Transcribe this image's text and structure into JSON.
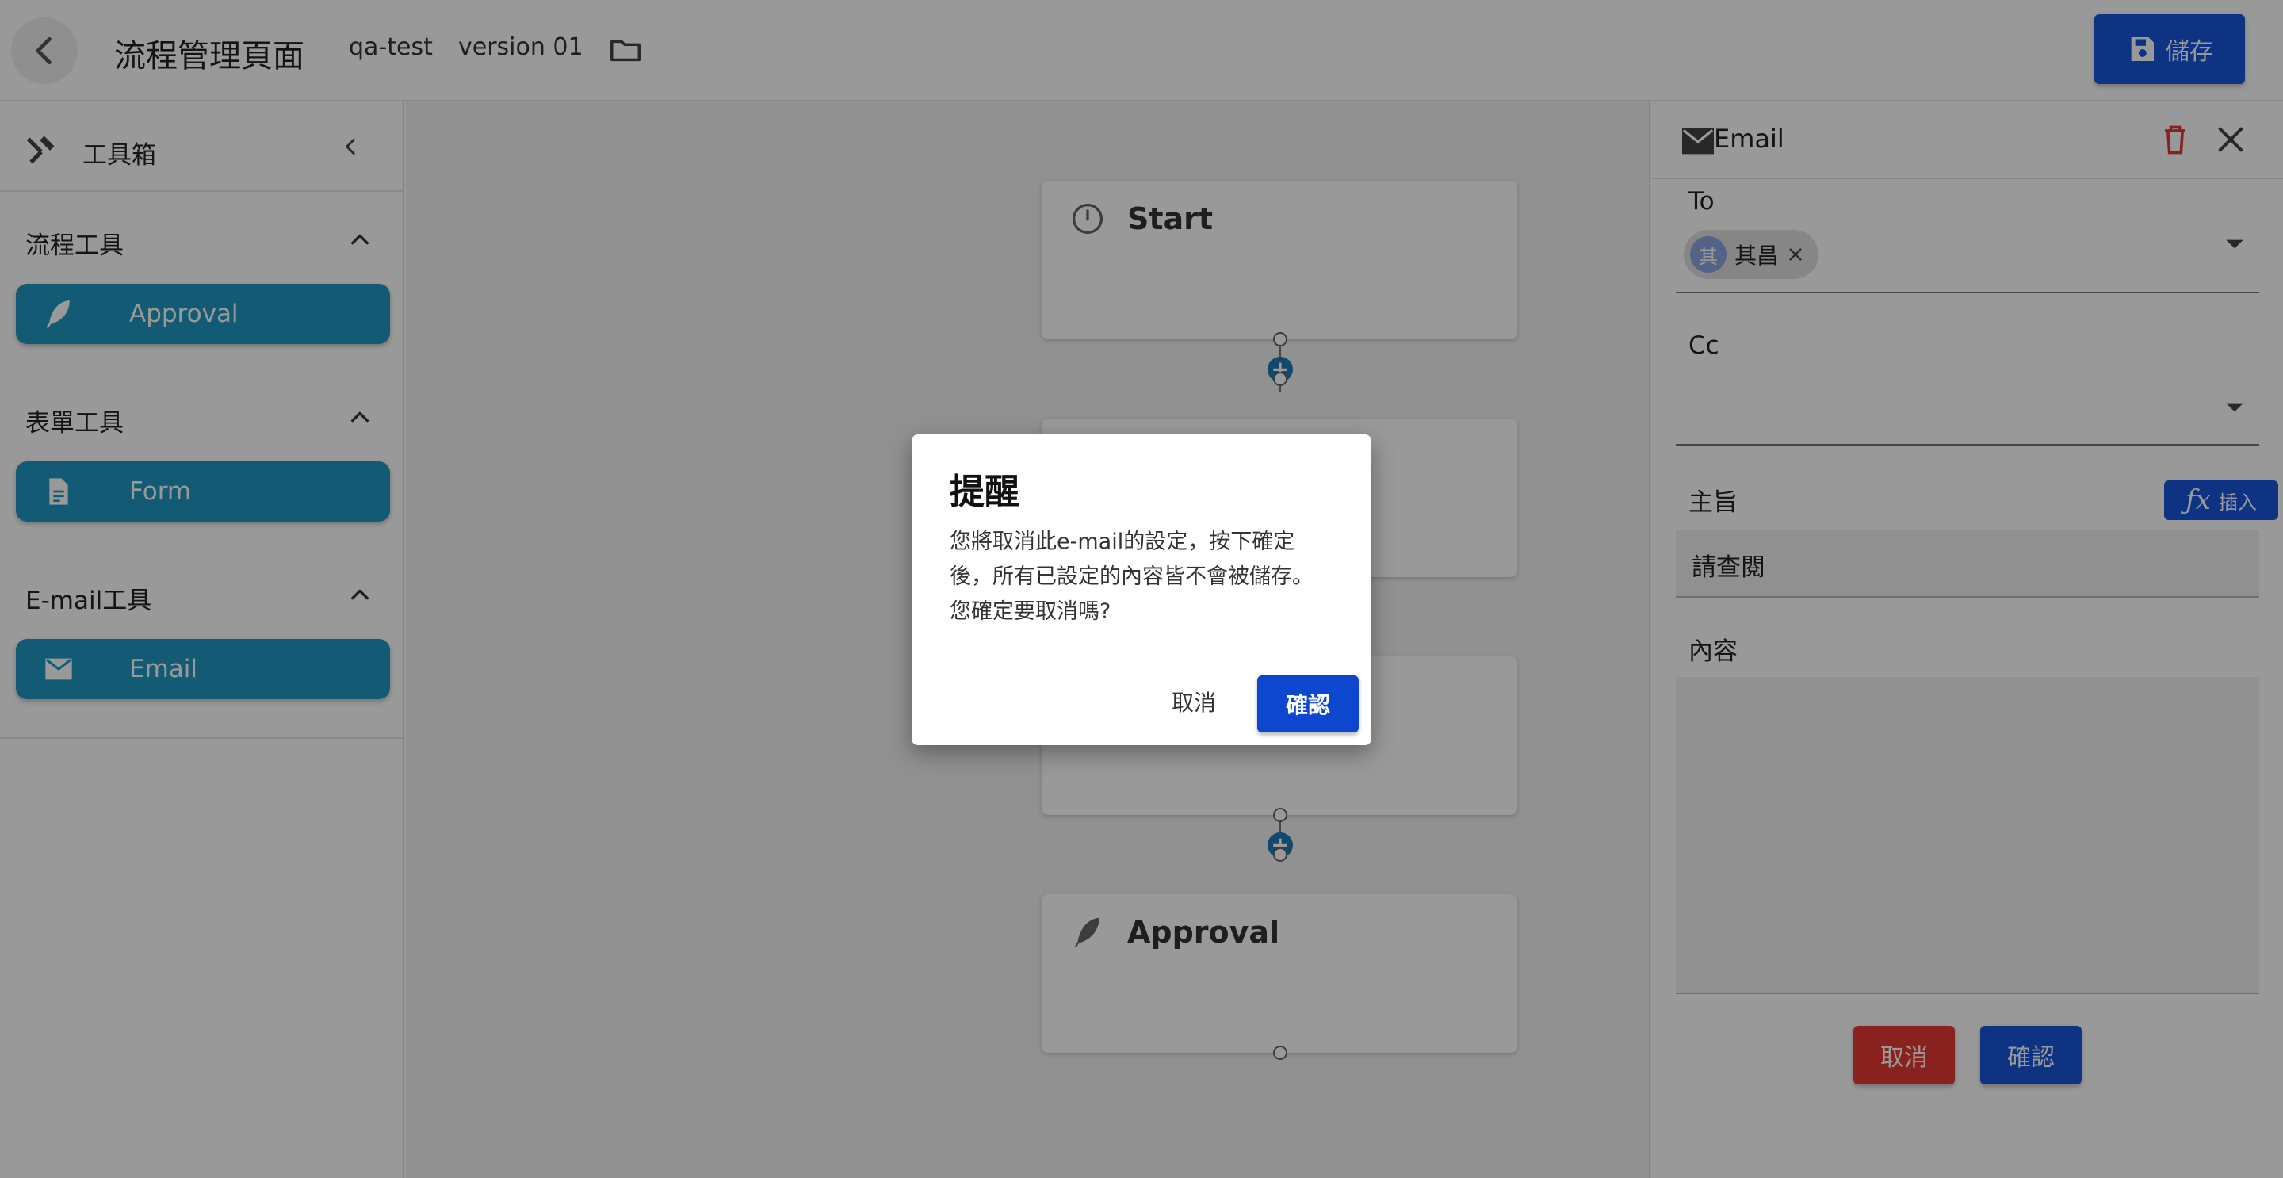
{
  "header": {
    "title": "流程管理頁面",
    "project": "qa-test",
    "version": "version 01",
    "save_label": "儲存"
  },
  "toolbox": {
    "title": "工具箱",
    "sections": [
      {
        "title": "流程工具",
        "tool": "Approval",
        "icon": "feather-icon"
      },
      {
        "title": "表單工具",
        "tool": "Form",
        "icon": "document-icon"
      },
      {
        "title": "E-mail工具",
        "tool": "Email",
        "icon": "mail-icon"
      }
    ]
  },
  "canvas": {
    "nodes": [
      {
        "label": "Start",
        "icon": "clock-icon"
      },
      {
        "label": "",
        "icon": ""
      },
      {
        "label": "",
        "icon": ""
      },
      {
        "label": "Approval",
        "icon": "feather-icon"
      }
    ]
  },
  "email_panel": {
    "title": "Email",
    "to_label": "To",
    "to_chip_avatar": "其",
    "to_chip_name": "其昌",
    "cc_label": "Cc",
    "subject_label": "主旨",
    "insert_label": "插入",
    "subject_value": "請查閱",
    "content_label": "內容",
    "cancel_label": "取消",
    "confirm_label": "確認"
  },
  "dialog": {
    "title": "提醒",
    "message_lines": [
      "您將取消此e-mail的設定，按下確定",
      "後，所有已設定的內容皆不會被儲存。",
      "您確定要取消嗎?"
    ],
    "cancel_label": "取消",
    "confirm_label": "確認"
  },
  "colors": {
    "tool_button": "#2196c4",
    "primary": "#1a56db",
    "danger": "#e53935",
    "overlay": "rgba(0,0,0,0.40)"
  }
}
